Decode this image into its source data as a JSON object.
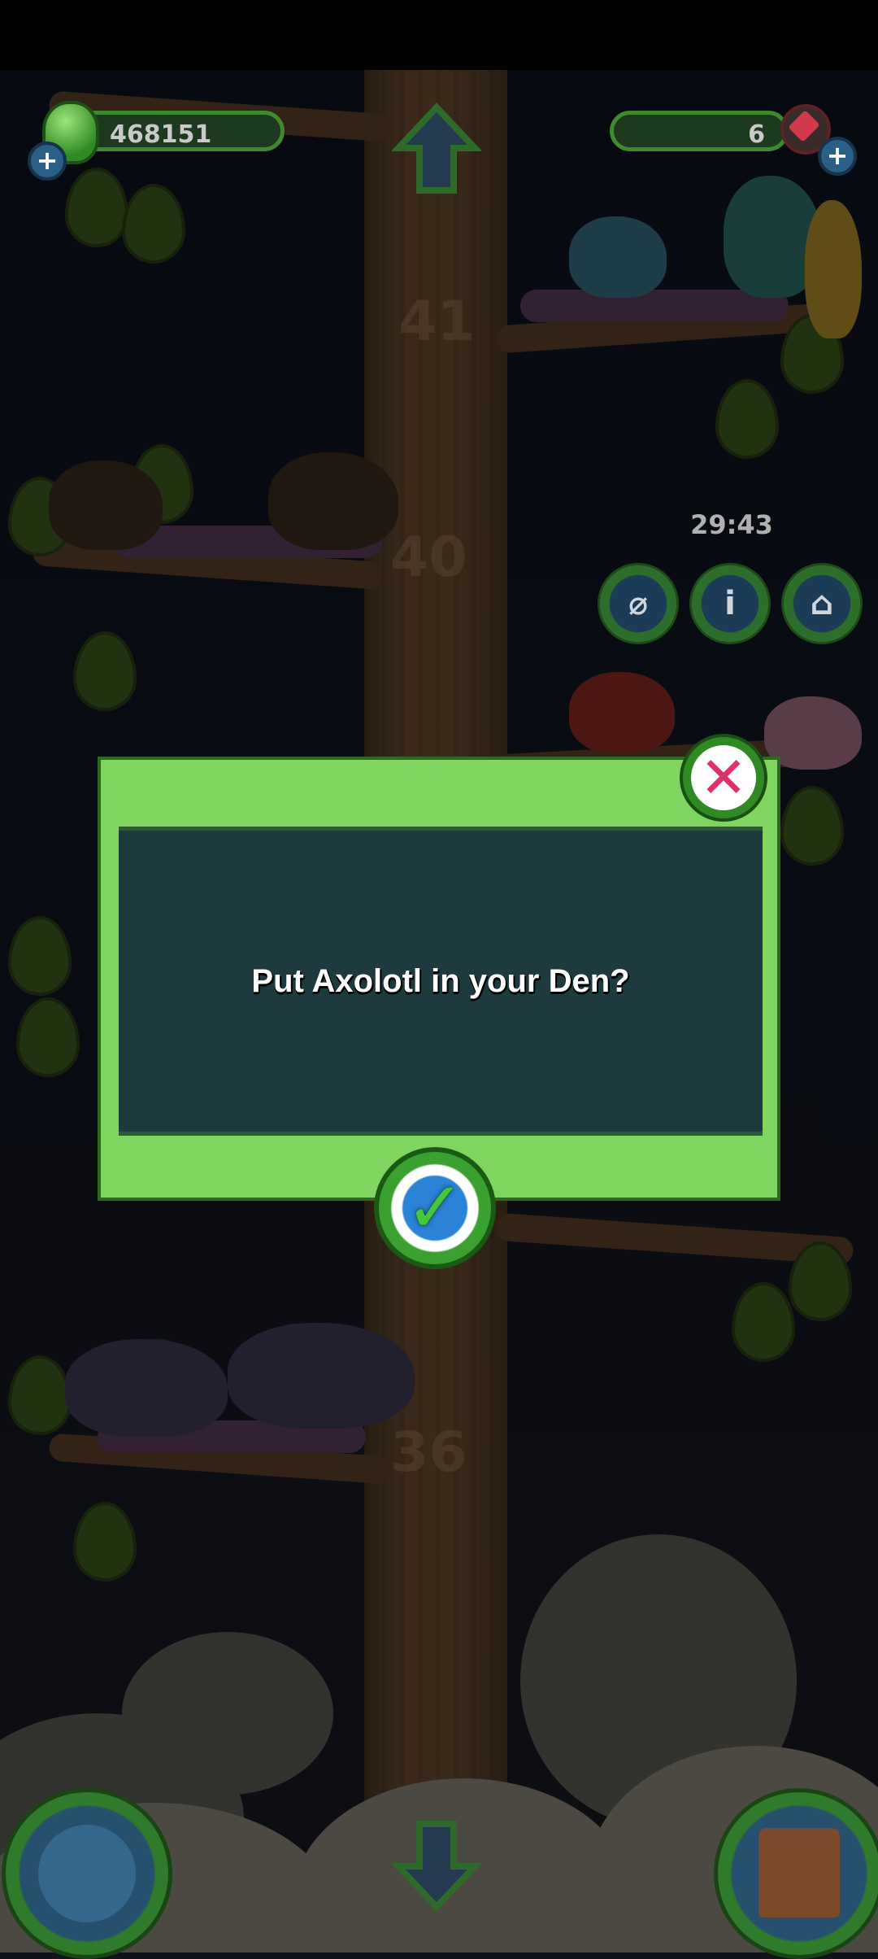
{
  "hud": {
    "currency_value": "468151",
    "gems_value": "6",
    "timer": "29:43"
  },
  "tree": {
    "floor_numbers": [
      "41",
      "40",
      "36"
    ]
  },
  "dialog": {
    "message": "Put Axolotl in your Den?"
  },
  "icons": {
    "currency": "green-gem-icon",
    "gems": "red-crystal-icon",
    "add": "plus-icon",
    "close": "close-x-icon",
    "confirm": "checkmark-icon",
    "up": "up-arrow-icon",
    "down": "down-arrow-icon",
    "net": "net-icon",
    "info": "info-icon",
    "den": "den-house-icon",
    "globe": "globe-icon",
    "home": "birdhouse-icon"
  },
  "colors": {
    "dialog_green": "#7fd55f",
    "dialog_panel": "#1d3a3f",
    "close_x": "#e0306c",
    "check": "#45c93a"
  }
}
